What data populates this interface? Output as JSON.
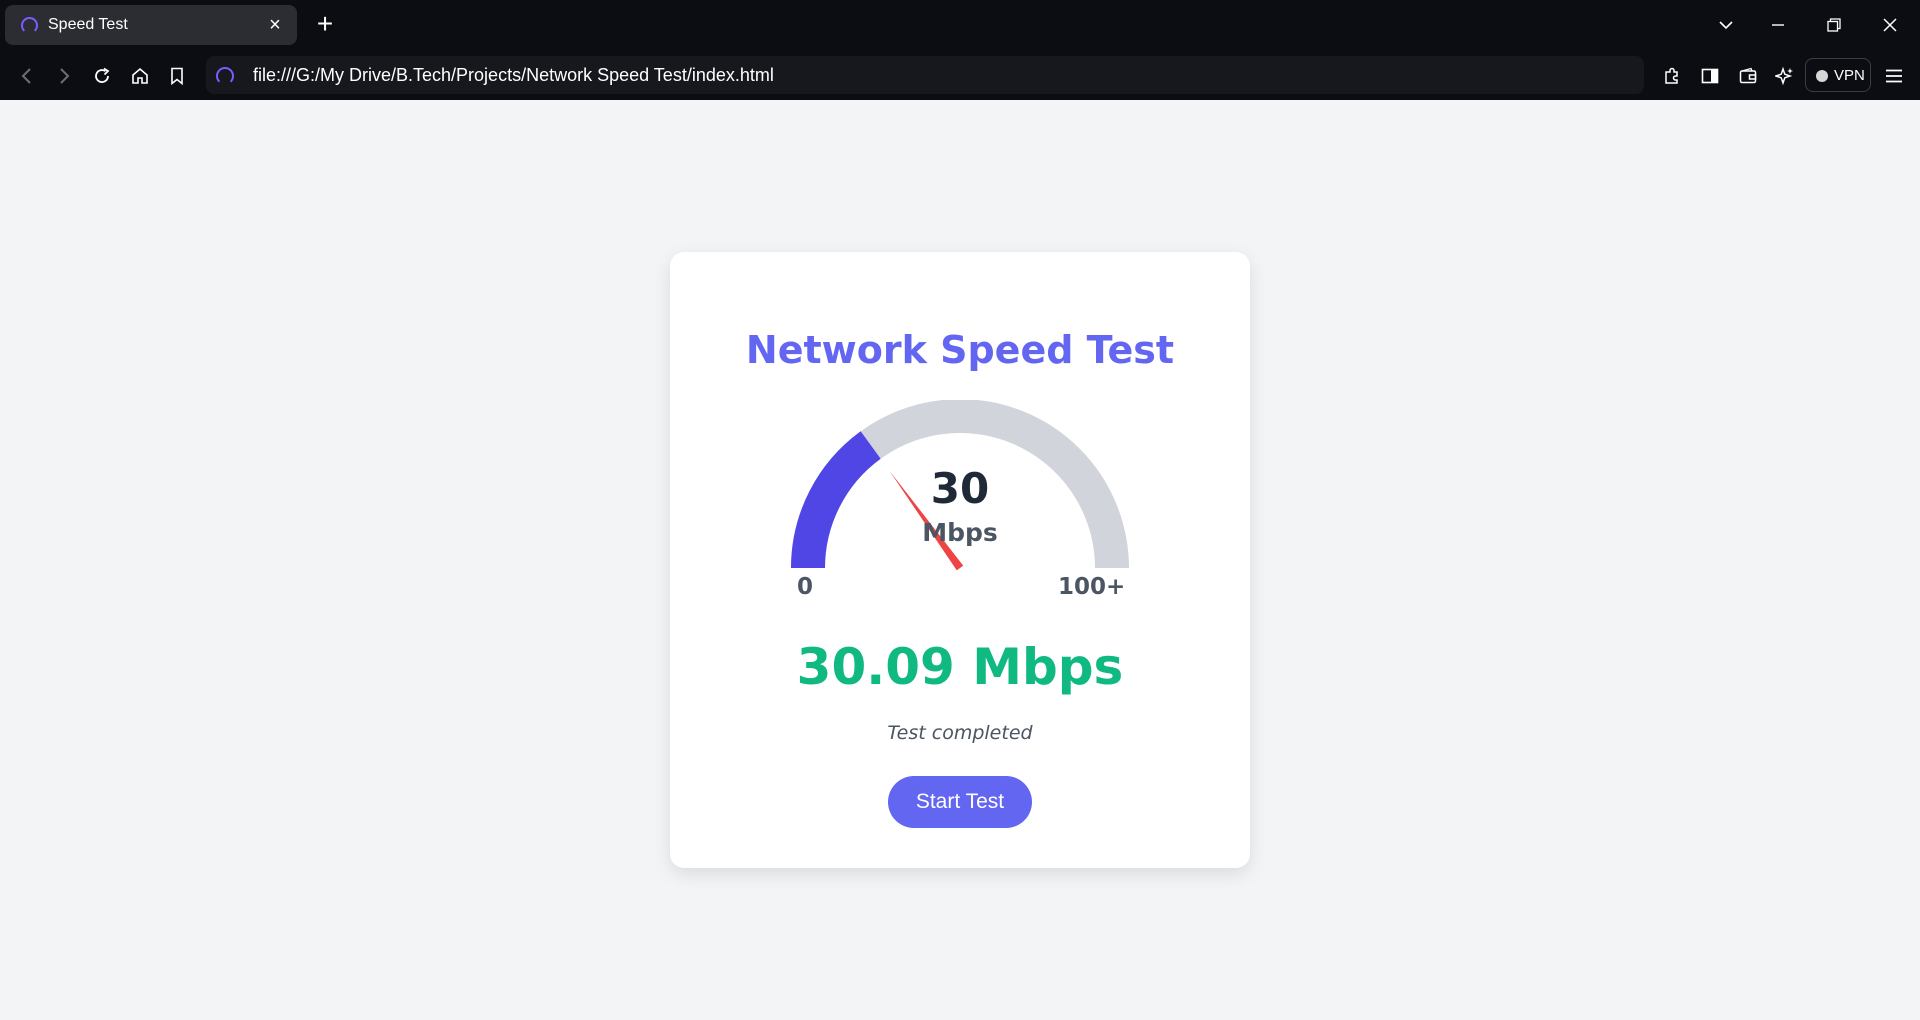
{
  "browser": {
    "tab_title": "Speed Test",
    "url": "file:///G:/My Drive/B.Tech/Projects/Network Speed Test/index.html",
    "vpn_label": "VPN"
  },
  "page": {
    "title": "Network Speed Test",
    "gauge": {
      "value": "30",
      "unit": "Mbps",
      "min_label": "0",
      "max_label": "100+",
      "fill_percent": 30
    },
    "result": "30.09 Mbps",
    "status": "Test completed",
    "start_button": "Start Test"
  },
  "colors": {
    "accent": "#6366f1",
    "gauge_fill": "#4f46e5",
    "gauge_track": "#d1d5db",
    "needle": "#ef4444",
    "result": "#10b981"
  }
}
